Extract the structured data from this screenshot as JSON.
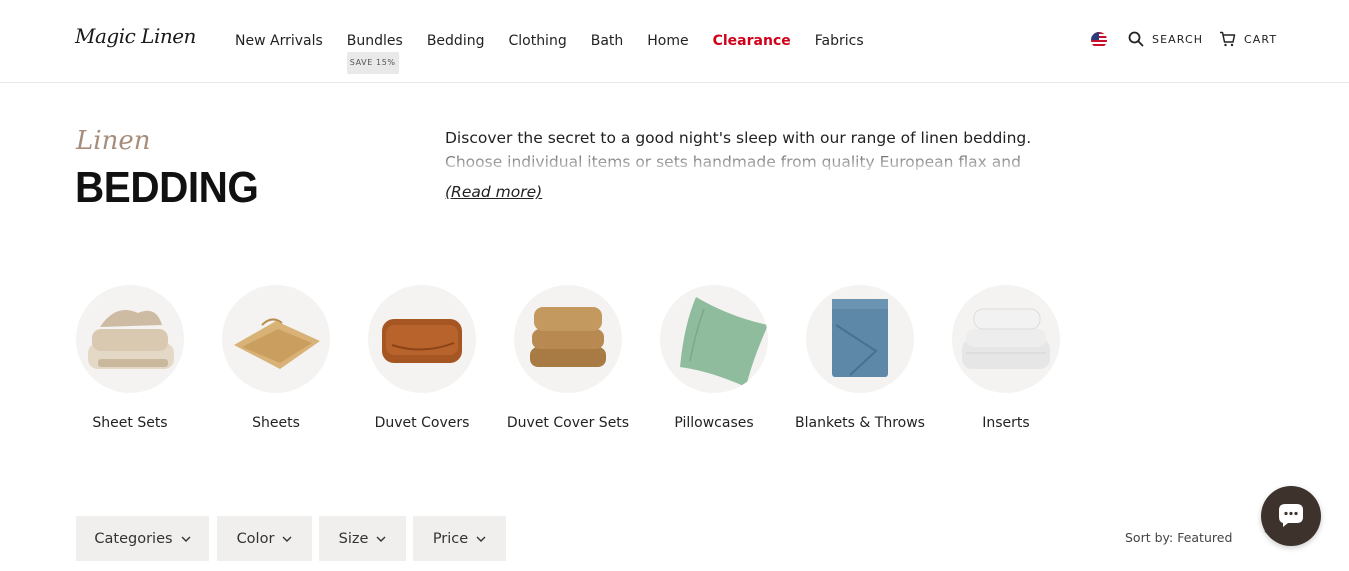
{
  "header": {
    "logo_text": "Magic Linen",
    "nav": [
      {
        "label": "New Arrivals"
      },
      {
        "label": "Bundles",
        "badge": "SAVE 15%"
      },
      {
        "label": "Bedding"
      },
      {
        "label": "Clothing"
      },
      {
        "label": "Bath"
      },
      {
        "label": "Home"
      },
      {
        "label": "Clearance"
      },
      {
        "label": "Fabrics"
      }
    ],
    "search_label": "SEARCH",
    "cart_label": "CART"
  },
  "hero": {
    "script_title": "Linen",
    "title": "BEDDING",
    "description": "Discover the secret to a good night's sleep with our range of linen bedding. Choose individual items or sets handmade from quality European flax and stone washed for",
    "read_more": "(Read more)"
  },
  "categories": [
    {
      "label": "Sheet Sets"
    },
    {
      "label": "Sheets"
    },
    {
      "label": "Duvet Covers"
    },
    {
      "label": "Duvet Cover Sets"
    },
    {
      "label": "Pillowcases"
    },
    {
      "label": "Blankets & Throws"
    },
    {
      "label": "Inserts"
    }
  ],
  "filters": [
    {
      "label": "Categories"
    },
    {
      "label": "Color"
    },
    {
      "label": "Size"
    },
    {
      "label": "Price"
    }
  ],
  "sort": {
    "label": "Sort by: Featured"
  },
  "colors": {
    "clearance": "#d0021b",
    "accent_script": "#a78e7c",
    "chat_bubble": "#3d322c",
    "filter_bg": "#f0efed"
  }
}
